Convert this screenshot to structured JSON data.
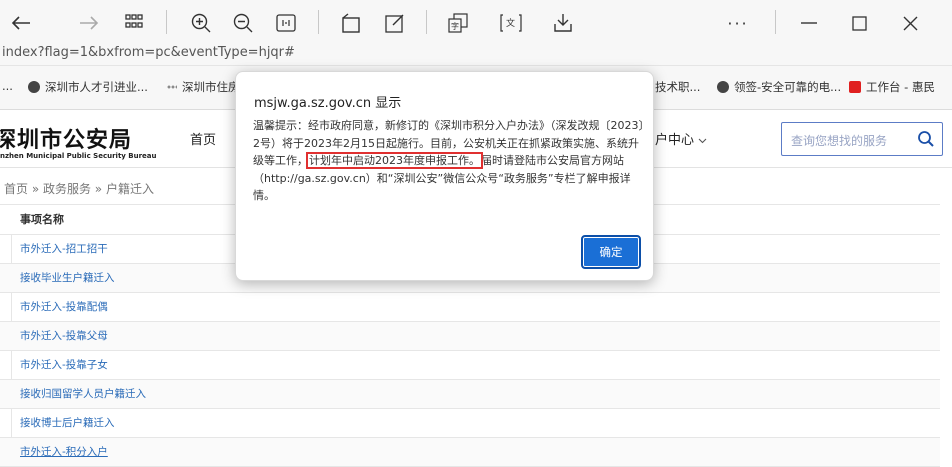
{
  "browser": {
    "address_url": "index?flag=1&bxfrom=pc&eventType=hjqr#",
    "menu_dots": "···",
    "bookmarks": [
      {
        "label": "...",
        "icon": "ellipsis"
      },
      {
        "label": "深圳市人才引进业...",
        "icon": "globe-icon"
      },
      {
        "label": "深圳市住房",
        "icon": "dots-icon"
      },
      {
        "label": "技术职...",
        "icon": "none"
      },
      {
        "label": "领签-安全可靠的电...",
        "icon": "globe-icon"
      },
      {
        "label": "工作台 - 惠民",
        "icon": "red-app-icon"
      }
    ]
  },
  "site": {
    "logo_title": "深圳市公安局",
    "logo_subtitle": "nzhen Municipal Public Security Bureau",
    "nav_home": "首页",
    "nav_user_center": "户中心",
    "search_placeholder": "查询您想找的服务"
  },
  "breadcrumb": "首页 » 政务服务 » 户籍迁入",
  "table": {
    "header": "事项名称",
    "rows": [
      "市外迁入-招工招干",
      "接收毕业生户籍迁入",
      "市外迁入-投靠配偶",
      "市外迁入-投靠父母",
      "市外迁入-投靠子女",
      "接收归国留学人员户籍迁入",
      "接收博士后户籍迁入",
      "市外迁入-积分入户"
    ]
  },
  "dialog": {
    "title": "msjw.ga.sz.gov.cn 显示",
    "body_part1": "温馨提示：经市政府同意，新修订的《深圳市积分入户办法》（深发改规〔2023〕2号）将于2023年2月15日起施行。目前，公安机关正在抓紧政策实施、系统升级等工作，",
    "body_highlight": "计划年中启动2023年度申报工作。",
    "body_part2": "届时请登陆市公安局官方网站（http://ga.sz.gov.cn）和“深圳公安”微信公众号“政务服务”专栏了解申报详情。",
    "ok_label": "确定"
  },
  "colors": {
    "accent": "#1a6fd6",
    "link": "#2a6bb8",
    "highlight_border": "#e03030"
  }
}
